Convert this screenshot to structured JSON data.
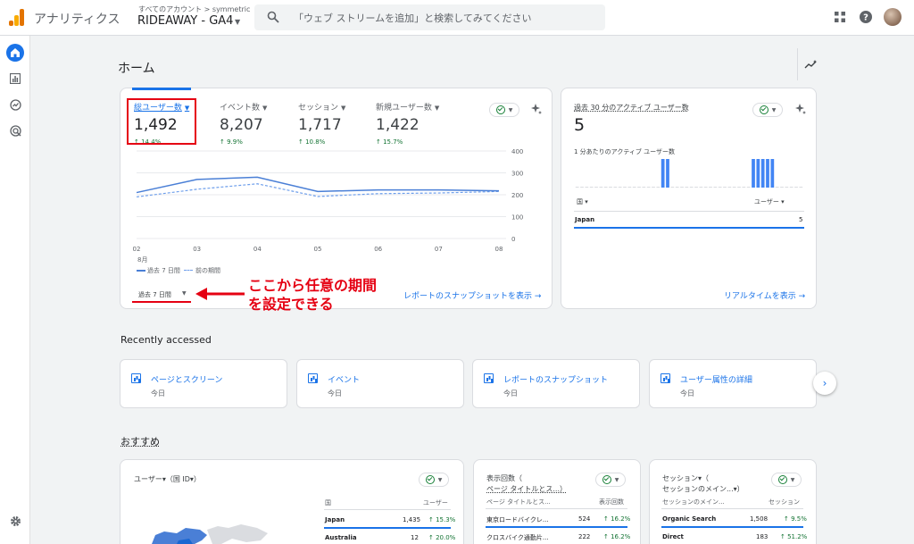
{
  "header": {
    "app_name": "アナリティクス",
    "account_path": "すべてのアカウント > symmetric",
    "property_name": "RIDEAWAY - GA4",
    "search_placeholder": "「ウェブ ストリームを追加」と検索してみてください"
  },
  "page": {
    "title": "ホーム"
  },
  "metrics_card": {
    "metrics": [
      {
        "label": "総ユーザー数",
        "value": "1,492",
        "change": "↑ 14.4%"
      },
      {
        "label": "イベント数",
        "value": "8,207",
        "change": "↑ 9.9%"
      },
      {
        "label": "セッション",
        "value": "1,717",
        "change": "↑ 10.8%"
      },
      {
        "label": "新規ユーザー数",
        "value": "1,422",
        "change": "↑ 15.7%"
      }
    ],
    "legend_current": "過去 7 日間",
    "legend_previous": "前の期間",
    "date_range": "過去 7 日間",
    "snapshot_link": "レポートのスナップショットを表示",
    "annotation_line1": "ここから任意の期間",
    "annotation_line2": "を設定できる"
  },
  "chart_data": {
    "type": "line",
    "x": [
      "02 8月",
      "03",
      "04",
      "05",
      "06",
      "07",
      "08"
    ],
    "x_tick_labels": [
      "02",
      "03",
      "04",
      "05",
      "06",
      "07",
      "08"
    ],
    "x_sub_label": "8月",
    "ylim": [
      0,
      400
    ],
    "y_ticks": [
      "400",
      "300",
      "200",
      "100",
      "0"
    ],
    "series": [
      {
        "name": "過去 7 日間",
        "values": [
          210,
          270,
          280,
          215,
          222,
          222,
          218
        ]
      },
      {
        "name": "前の期間",
        "values": [
          190,
          225,
          250,
          192,
          205,
          208,
          215
        ]
      }
    ],
    "colors": {
      "current": "#4a7fd6",
      "previous": "#6d9eeb"
    }
  },
  "realtime_card": {
    "title": "過去 30 分のアクティブ ユーザー数",
    "value": "5",
    "subtitle": "1 分あたりのアクティブ ユーザー数",
    "per_minute_bars": [
      0,
      0,
      0,
      0,
      0,
      0,
      0,
      0,
      0,
      0,
      0,
      0,
      0,
      0,
      0,
      0,
      0,
      0,
      1,
      1,
      0,
      0,
      0,
      0,
      0,
      0,
      0,
      0,
      0,
      0,
      0,
      0,
      0,
      0,
      0,
      0,
      0,
      1,
      1,
      1,
      1,
      1,
      0,
      0,
      0,
      0,
      0,
      0
    ],
    "col_country": "国",
    "col_users": "ユーザー",
    "row_country": "Japan",
    "row_value": "5",
    "link": "リアルタイムを表示"
  },
  "recent": {
    "heading": "Recently accessed",
    "items": [
      {
        "title": "ページとスクリーン",
        "sub": "今日"
      },
      {
        "title": "イベント",
        "sub": "今日"
      },
      {
        "title": "レポートのスナップショット",
        "sub": "今日"
      },
      {
        "title": "ユーザー属性の詳細",
        "sub": "今日"
      }
    ]
  },
  "recommended": {
    "heading": "おすすめ",
    "users_card": {
      "title": "ユーザー▾（国 ID▾）",
      "col1": "国",
      "col2": "ユーザー",
      "rows": [
        {
          "name": "Japan",
          "value": "1,435",
          "change": "↑ 15.3%"
        },
        {
          "name": "Australia",
          "value": "12",
          "change": "↑ 20.0%"
        }
      ]
    },
    "views_card": {
      "title_line1": "表示回数（",
      "title_line2": "ページ タイトルとス...）",
      "col1": "ページ タイトルとス...",
      "col2": "表示回数",
      "rows": [
        {
          "name": "東京ロードバイクレ...",
          "value": "524",
          "change": "↑ 16.2%"
        },
        {
          "name": "クロスバイク通勤片...",
          "value": "222",
          "change": "↑ 16.2%"
        }
      ]
    },
    "sessions_card": {
      "title_line1": "セッション▾（",
      "title_line2": "セッションのメイン...▾）",
      "col1": "セッションのメイン...",
      "col2": "セッション",
      "rows": [
        {
          "name": "Organic Search",
          "value": "1,508",
          "change": "↑ 9.5%"
        },
        {
          "name": "Direct",
          "value": "183",
          "change": "↑ 51.2%"
        }
      ]
    }
  }
}
